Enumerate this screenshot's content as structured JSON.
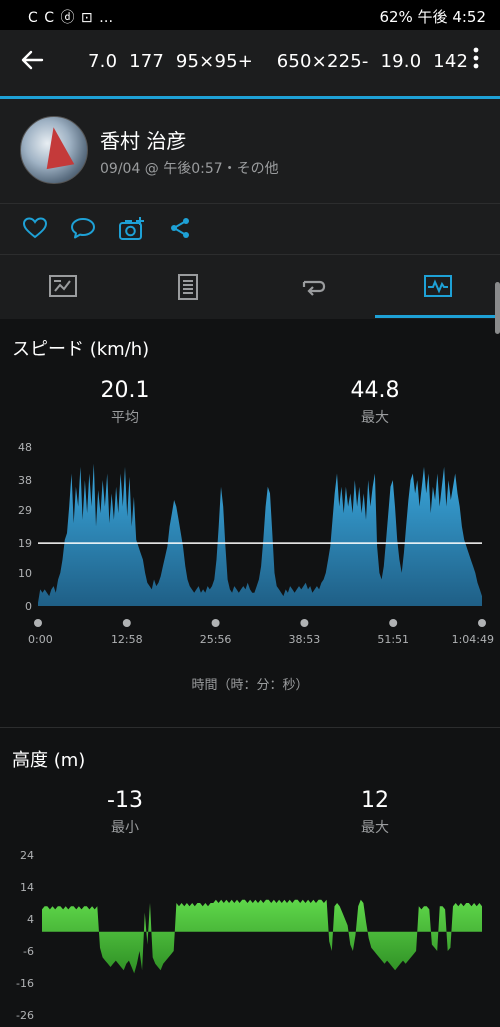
{
  "status": {
    "left_icons": "C C ⓓ ⊡ …",
    "right": "62%  午後 4:52"
  },
  "appbar": {
    "title": "7.0  177  95×95+    650×225-  19.0  142"
  },
  "profile": {
    "name": "香村 治彦",
    "meta": "09/04 @ 午後0:57・その他"
  },
  "colors": {
    "accent": "#1ea1d6",
    "speed_fill": "#2f93c9",
    "altitude_fill": "#4cc83c"
  },
  "speed": {
    "title": "スピード (km/h)",
    "avg_value": "20.1",
    "avg_label": "平均",
    "max_value": "44.8",
    "max_label": "最大",
    "x_axis_label": "時間（時：分：秒）"
  },
  "altitude": {
    "title": "高度 (m)",
    "min_value": "-13",
    "min_label": "最小",
    "max_value": "12",
    "max_label": "最大"
  },
  "chart_data": [
    {
      "type": "area",
      "title": "スピード (km/h)",
      "xlabel": "時間（時：分：秒）",
      "ylabel": "",
      "y_ticks": [
        0,
        10,
        19,
        29,
        38,
        48
      ],
      "x_ticks": [
        "0:00",
        "12:58",
        "25:56",
        "38:53",
        "51:51",
        "1:04:49"
      ],
      "ylim": [
        0,
        48
      ],
      "reference_line": 19,
      "series": [
        {
          "values": [
            1,
            5,
            4,
            5,
            4,
            3,
            5,
            6,
            4,
            8,
            10,
            14,
            20,
            22,
            30,
            40,
            25,
            36,
            30,
            42,
            26,
            38,
            28,
            40,
            30,
            43,
            24,
            35,
            28,
            38,
            30,
            40,
            25,
            34,
            26,
            36,
            28,
            40,
            30,
            42,
            27,
            39,
            24,
            33,
            20,
            18,
            16,
            14,
            10,
            7,
            6,
            5,
            8,
            6,
            7,
            9,
            12,
            15,
            18,
            24,
            28,
            32,
            30,
            26,
            22,
            18,
            12,
            8,
            6,
            5,
            4,
            5,
            6,
            4,
            5,
            4,
            6,
            5,
            6,
            8,
            14,
            24,
            36,
            30,
            18,
            8,
            5,
            4,
            6,
            5,
            4,
            5,
            6,
            5,
            7,
            5,
            4,
            4,
            6,
            8,
            12,
            20,
            30,
            36,
            34,
            22,
            10,
            6,
            5,
            4,
            3,
            5,
            4,
            6,
            5,
            4,
            5,
            6,
            5,
            6,
            7,
            5,
            6,
            4,
            5,
            6,
            5,
            7,
            8,
            10,
            14,
            18,
            26,
            34,
            40,
            30,
            36,
            28,
            36,
            30,
            34,
            28,
            38,
            30,
            36,
            28,
            34,
            26,
            38,
            30,
            36,
            40,
            18,
            10,
            8,
            12,
            20,
            28,
            36,
            38,
            30,
            20,
            14,
            10,
            16,
            24,
            32,
            38,
            40,
            34,
            38,
            30,
            36,
            42,
            34,
            40,
            28,
            36,
            32,
            40,
            30,
            36,
            42,
            30,
            38,
            32,
            36,
            40,
            34,
            30,
            24,
            20,
            18,
            16,
            14,
            12,
            10,
            7,
            5,
            3
          ]
        }
      ]
    },
    {
      "type": "area",
      "title": "高度 (m)",
      "xlabel": "",
      "ylabel": "",
      "y_ticks": [
        -26,
        -16,
        -6,
        4,
        14,
        24
      ],
      "ylim": [
        -26,
        24
      ],
      "series": [
        {
          "values": [
            7,
            8,
            8,
            7,
            8,
            7,
            8,
            8,
            7,
            8,
            7,
            8,
            8,
            7,
            8,
            7,
            8,
            8,
            7,
            8,
            7,
            8,
            -5,
            -8,
            -9,
            -10,
            -11,
            -10,
            -9,
            -10,
            -11,
            -12,
            -10,
            -9,
            -11,
            -13,
            -10,
            -6,
            -12,
            6,
            -4,
            9,
            -8,
            -10,
            -11,
            -12,
            -10,
            -9,
            -8,
            -7,
            -6,
            9,
            8,
            9,
            8,
            9,
            8,
            9,
            8,
            9,
            9,
            8,
            9,
            8,
            9,
            9,
            10,
            9,
            10,
            9,
            10,
            9,
            10,
            9,
            10,
            9,
            10,
            10,
            9,
            10,
            9,
            10,
            9,
            10,
            9,
            10,
            10,
            9,
            10,
            9,
            10,
            9,
            10,
            9,
            10,
            9,
            10,
            10,
            9,
            10,
            9,
            10,
            9,
            10,
            9,
            10,
            10,
            9,
            10,
            -3,
            -6,
            8,
            9,
            8,
            6,
            4,
            2,
            -4,
            -6,
            -1,
            8,
            10,
            9,
            3,
            -2,
            -5,
            -6,
            -7,
            -8,
            -9,
            -10,
            -9,
            -10,
            -11,
            -12,
            -11,
            -10,
            -9,
            -10,
            -9,
            -8,
            -7,
            -6,
            8,
            7,
            8,
            8,
            7,
            -4,
            -5,
            -6,
            8,
            8,
            7,
            -6,
            -5,
            8,
            9,
            8,
            9,
            8,
            9,
            9,
            8,
            9,
            8,
            9,
            8
          ]
        }
      ]
    }
  ]
}
